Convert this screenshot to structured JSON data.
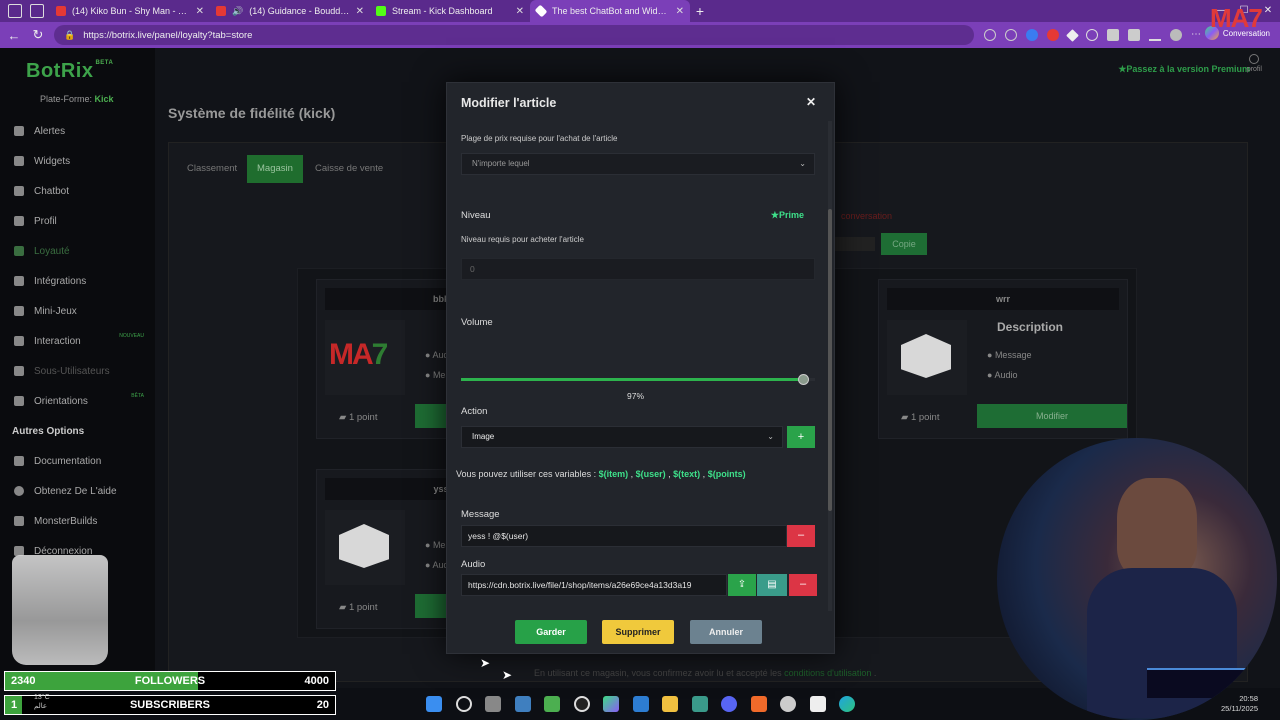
{
  "browser": {
    "tabs": [
      {
        "title": "(14) Kiko Bun - Shy Man - YouTub",
        "fav": "#e53935"
      },
      {
        "title": "(14) Guidance - Bouddhama",
        "fav": "#e53935"
      },
      {
        "title": "Stream - Kick Dashboard",
        "fav": "#53fc18"
      },
      {
        "title": "The best ChatBot and Widgets fo",
        "fav": "#ffffff"
      }
    ],
    "url": "https://botrix.live/panel/loyalty?tab=store",
    "conversation_label": "Conversation"
  },
  "app": {
    "logo": "BotRix",
    "logo_badge": "BETA",
    "platform_label": "Plate-Forme:",
    "platform_value": "Kick",
    "premium_link": "Passez à la version Premium",
    "profile_label": "profil",
    "menu": [
      {
        "label": "Alertes",
        "state": ""
      },
      {
        "label": "Widgets",
        "state": ""
      },
      {
        "label": "Chatbot",
        "state": ""
      },
      {
        "label": "Profil",
        "state": ""
      },
      {
        "label": "Loyauté",
        "state": "active"
      },
      {
        "label": "Intégrations",
        "state": ""
      },
      {
        "label": "Mini-Jeux",
        "state": ""
      },
      {
        "label": "Interaction",
        "state": "",
        "badge": "NOUVEAU"
      },
      {
        "label": "Sous-Utilisateurs",
        "state": "dim"
      },
      {
        "label": "Orientations",
        "state": "",
        "badge": "BÊTA"
      }
    ],
    "other_options_title": "Autres Options",
    "other_menu": [
      {
        "label": "Documentation"
      },
      {
        "label": "Obtenez De L'aide"
      },
      {
        "label": "MonsterBuilds"
      },
      {
        "label": "Déconnexion"
      }
    ],
    "page_title": "Système de fidélité (kick)",
    "tabs": [
      "Classement",
      "Magasin",
      "Caisse de vente"
    ],
    "copy_label": "Copie",
    "red_notice": "conversation",
    "footer_note_prefix": "En utilisant ce magasin, vous confirmez avoir lu et accepté les",
    "footer_note_link": "conditions d'utilisation",
    "cards": [
      {
        "title": "bbk",
        "points": "1 point",
        "m1": "Audi",
        "m2": "Mes"
      },
      {
        "title": "wrr",
        "points": "1 point",
        "description": "Description",
        "m1": "Message",
        "m2": "Audio",
        "button": "Modifier"
      },
      {
        "title": "yss",
        "points": "1 point",
        "m1": "Mes",
        "m2": "Audi"
      }
    ]
  },
  "modal": {
    "title": "Modifier l'article",
    "price_range_label": "Plage de prix requise pour l'achat de l'article",
    "price_range_value": "N'importe lequel",
    "level_label": "Niveau",
    "prime_label": "Prime",
    "level_help": "Niveau requis pour acheter l'article",
    "level_value": "0",
    "volume_label": "Volume",
    "volume_value": 97,
    "volume_text": "97%",
    "action_label": "Action",
    "action_value": "Image",
    "vars_prefix": "Vous pouvez utiliser ces variables :",
    "vars": [
      "$(item)",
      "$(user)",
      "$(text)",
      "$(points)"
    ],
    "message_label": "Message",
    "message_value": "yess !  @$(user)",
    "audio_label": "Audio",
    "audio_value": "https://cdn.botrix.live/file/1/shop/items/a26e69ce4a13d3a19",
    "buttons": {
      "save": "Garder",
      "delete": "Supprimer",
      "cancel": "Annuler"
    }
  },
  "overlay": {
    "followers": {
      "current": "2340",
      "label": "FOLLOWERS",
      "goal": "4000",
      "progress": 0.585
    },
    "subscribers": {
      "current": "1",
      "label": "SUBSCRIBERS",
      "goal": "20",
      "progress": 0.05
    },
    "mao_logo": "MA7"
  },
  "taskbar": {
    "temp": "13°C",
    "weather_sub": "عالم",
    "time": "20:58",
    "date": "25/11/2025"
  }
}
